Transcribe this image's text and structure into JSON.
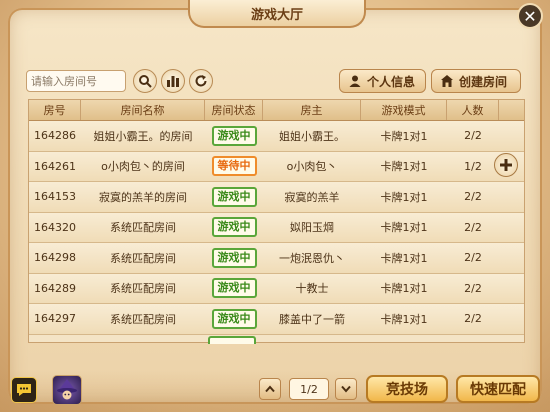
{
  "header": {
    "title": "游戏大厅",
    "close_icon": "close-icon"
  },
  "search": {
    "placeholder": "请输入房间号"
  },
  "toolbar": {
    "profile_label": "个人信息",
    "create_room_label": "创建房间"
  },
  "table": {
    "headers": [
      "房号",
      "房间名称",
      "房间状态",
      "房主",
      "游戏模式",
      "人数"
    ],
    "rows": [
      {
        "id": "164286",
        "name": "姐姐小霸王。的房间",
        "status": "游戏中",
        "status_type": "playing",
        "owner": "姐姐小霸王。",
        "mode": "卡牌1对1",
        "players": "2/2"
      },
      {
        "id": "164261",
        "name": "o小肉包丶的房间",
        "status": "等待中",
        "status_type": "waiting",
        "owner": "o小肉包丶",
        "mode": "卡牌1对1",
        "players": "1/2"
      },
      {
        "id": "164153",
        "name": "寂寞的羔羊的房间",
        "status": "游戏中",
        "status_type": "playing",
        "owner": "寂寞的羔羊",
        "mode": "卡牌1对1",
        "players": "2/2"
      },
      {
        "id": "164320",
        "name": "系统匹配房间",
        "status": "游戏中",
        "status_type": "playing",
        "owner": "姒阳玉焵",
        "mode": "卡牌1对1",
        "players": "2/2"
      },
      {
        "id": "164298",
        "name": "系统匹配房间",
        "status": "游戏中",
        "status_type": "playing",
        "owner": "一炮泯恩仇丶",
        "mode": "卡牌1对1",
        "players": "2/2"
      },
      {
        "id": "164289",
        "name": "系统匹配房间",
        "status": "游戏中",
        "status_type": "playing",
        "owner": "十教士",
        "mode": "卡牌1对1",
        "players": "2/2"
      },
      {
        "id": "164297",
        "name": "系统匹配房间",
        "status": "游戏中",
        "status_type": "playing",
        "owner": "膝盖中了一箭",
        "mode": "卡牌1对1",
        "players": "2/2"
      }
    ]
  },
  "pagination": {
    "page": "1/2"
  },
  "bottom": {
    "arena_label": "竞技场",
    "quick_match_label": "快速匹配"
  },
  "colors": {
    "playing": "#3a8a1a",
    "waiting": "#e86a10",
    "accent": "#f1b74a",
    "frame": "#c99558"
  }
}
